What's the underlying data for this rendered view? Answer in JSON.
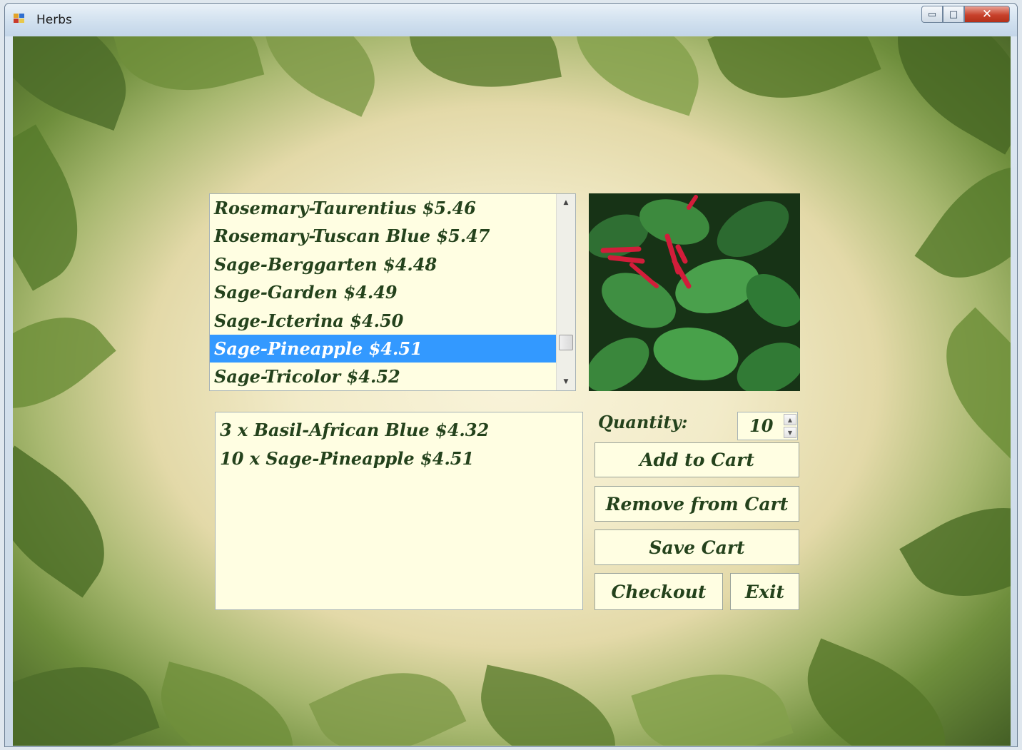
{
  "window": {
    "title": "Herbs",
    "controls": {
      "minimize": "▭",
      "maximize": "□",
      "close": "✕"
    }
  },
  "product_list": {
    "items": [
      "Rosemary-Taurentius $5.46",
      "Rosemary-Tuscan Blue $5.47",
      "Sage-Berggarten $4.48",
      "Sage-Garden $4.49",
      "Sage-Icterina $4.50",
      "Sage-Pineapple $4.51",
      "Sage-Tricolor $4.52"
    ],
    "selected": "Sage-Pineapple $4.51"
  },
  "cart": {
    "items": [
      "3 x Basil-African Blue $4.32",
      "10 x Sage-Pineapple $4.51"
    ]
  },
  "quantity": {
    "label": "Quantity:",
    "value": "10"
  },
  "buttons": {
    "add": "Add to Cart",
    "remove": "Remove from Cart",
    "save": "Save Cart",
    "checkout": "Checkout",
    "exit": "Exit"
  },
  "colors": {
    "selection": "#3399ff",
    "panel": "#fffee2",
    "text": "#24421c"
  }
}
